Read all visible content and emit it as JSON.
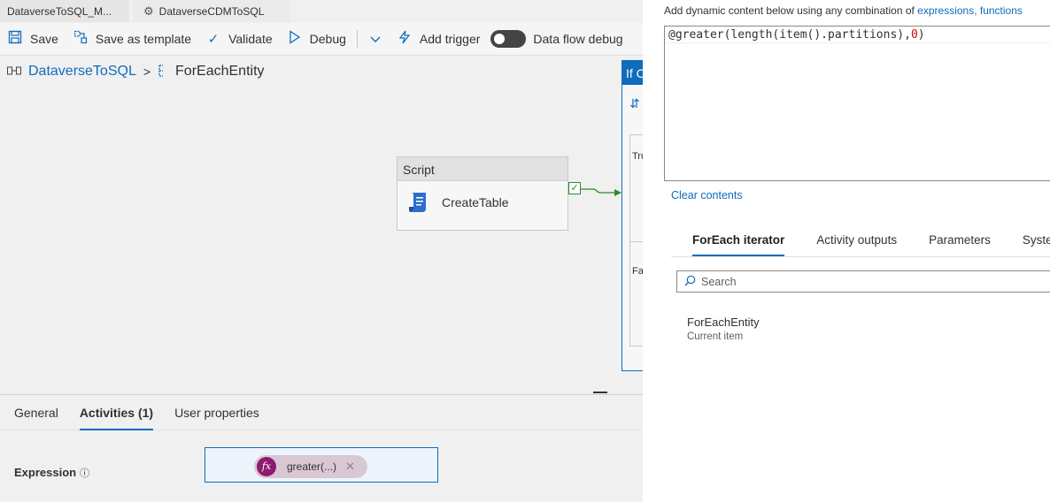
{
  "tabs": [
    {
      "label": "DataverseToSQL_M..."
    },
    {
      "label": "DataverseCDMToSQL",
      "icon": "pipeline-icon"
    }
  ],
  "toolbar": {
    "save": "Save",
    "save_template": "Save as template",
    "validate": "Validate",
    "debug": "Debug",
    "add_trigger": "Add trigger",
    "dataflow_debug": "Data flow debug"
  },
  "breadcrumb": {
    "pipeline": "DataverseToSQL",
    "separator": ">",
    "current": "ForEachEntity"
  },
  "canvas": {
    "script_activity": {
      "type": "Script",
      "name": "CreateTable"
    },
    "if_condition": {
      "label": "If C",
      "true_label": "Tru",
      "false_label": "Fa"
    }
  },
  "bottom_panel": {
    "tabs": [
      "General",
      "Activities (1)",
      "User properties"
    ],
    "active_tab": "Activities (1)",
    "expression_label": "Expression",
    "expression_pill": "greater(...)"
  },
  "right_panel": {
    "hint_text": "Add dynamic content below using any combination of ",
    "hint_link": "expressions, functions",
    "expression_prefix": "@greater(length(item().partitions),",
    "expression_number": "0",
    "expression_suffix": ")",
    "clear_contents": "Clear contents",
    "tabs": [
      "ForEach iterator",
      "Activity outputs",
      "Parameters",
      "System var"
    ],
    "active_tab": "ForEach iterator",
    "search_placeholder": "Search",
    "items": [
      {
        "title": "ForEachEntity",
        "subtitle": "Current item"
      }
    ]
  },
  "colors": {
    "accent": "#0f6cbd",
    "highlight": "#ffff3a",
    "fx_badge": "#8e1b6f",
    "success": "#2d8a2d"
  }
}
